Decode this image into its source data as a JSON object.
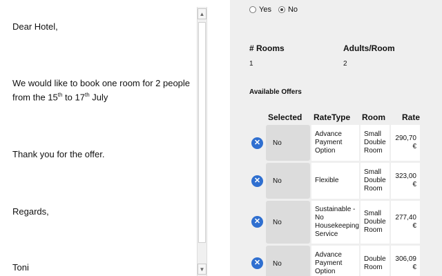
{
  "email": {
    "greeting": "Dear Hotel,",
    "body_line1": "We would like to book one room for 2 people",
    "body_line2_pre": "from the 15",
    "body_line2_sup1": "th",
    "body_line2_mid": " to 17",
    "body_line2_sup2": "th",
    "body_line2_post": " July",
    "thanks": "Thank you for the offer.",
    "closing": "Regards,",
    "signature": "Toni"
  },
  "scrollbar": {
    "up_glyph": "▲",
    "down_glyph": "▼"
  },
  "booking": {
    "radio_yes": "Yes",
    "radio_no": "No",
    "rooms_header": "# Rooms",
    "adults_header": "Adults/Room",
    "rooms_value": "1",
    "adults_value": "2",
    "offers_title": "Available Offers",
    "columns": {
      "selected": "Selected",
      "ratetype": "RateType",
      "room": "Room",
      "rate": "Rate"
    },
    "offers": [
      {
        "selected": "No",
        "ratetype": "Advance Payment Option",
        "room": "Small Double Room",
        "rate": "290,70 €"
      },
      {
        "selected": "No",
        "ratetype": "Flexible",
        "room": "Small Double Room",
        "rate": "323,00 €"
      },
      {
        "selected": "No",
        "ratetype": "Sustainable - No Housekeeping Service",
        "room": "Small Double Room",
        "rate": "277,40 €"
      },
      {
        "selected": "No",
        "ratetype": "Advance Payment Option",
        "room": "Double Room",
        "rate": "306,09 €"
      }
    ],
    "remove_glyph": "✕"
  }
}
